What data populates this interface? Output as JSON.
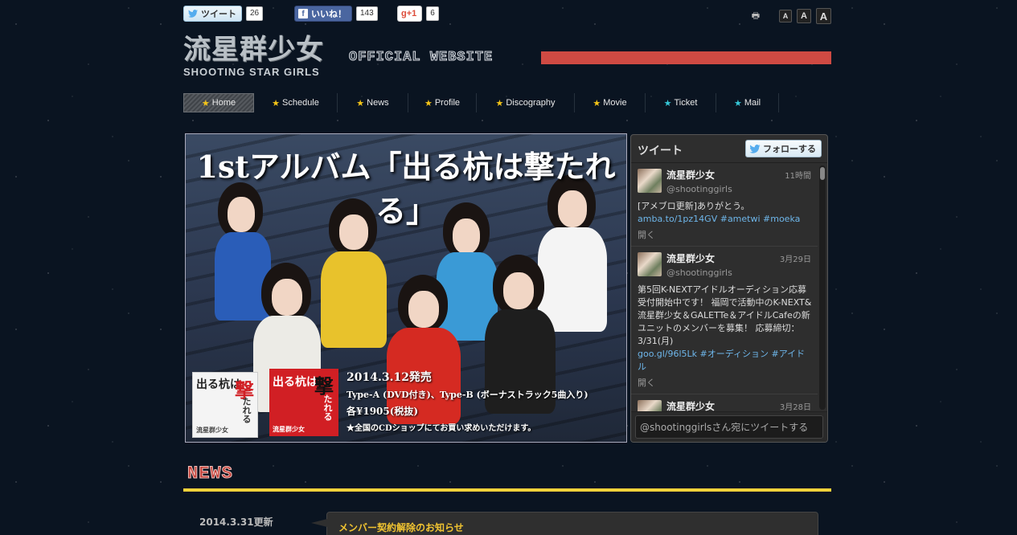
{
  "social": {
    "tweet_label": "ツイート",
    "tweet_count": "26",
    "like_label": "いいね！",
    "like_count": "143",
    "gplus_label": "+1",
    "gplus_count": "6",
    "font_sizes": [
      "A",
      "A",
      "A"
    ]
  },
  "header": {
    "logo_jp": "流星群少女",
    "logo_en": "SHOOTING STAR GIRLS",
    "tagline": "OFFICIAL WEBSITE",
    "bar_color": "#cf4a43"
  },
  "nav": [
    {
      "label": "Home",
      "star_color": "#f5c518"
    },
    {
      "label": "Schedule",
      "star_color": "#f5c518"
    },
    {
      "label": "News",
      "star_color": "#f5c518"
    },
    {
      "label": "Profile",
      "star_color": "#f5c518"
    },
    {
      "label": "Discography",
      "star_color": "#f5c518"
    },
    {
      "label": "Movie",
      "star_color": "#f5c518"
    },
    {
      "label": "Ticket",
      "star_color": "#35c8d8"
    },
    {
      "label": "Mail",
      "star_color": "#35c8d8"
    }
  ],
  "hero": {
    "title": "1stアルバム「出る杭は撃たれる」",
    "jacket_text_a": "出る杭は",
    "jacket_text_b": "撃",
    "jacket_text_c": "たれる",
    "jacket_brand": "流星群少女",
    "release": "2014.3.12発売",
    "types": "Type-A (DVD付き)、Type-B (ボーナストラック5曲入り)",
    "price": "各¥1905(税抜)",
    "note": "★全国のCDショップにてお買い求めいただけます。"
  },
  "twitter": {
    "header": "ツイート",
    "follow": "フォローする",
    "compose": "@shootinggirlsさん宛にツイートする",
    "tweets": [
      {
        "name": "流星群少女",
        "handle": "@shootinggirls",
        "time": "11時間",
        "text": "[アメブロ更新]ありがとう。",
        "links": "amba.to/1pz14GV #ametwi #moeka",
        "open": "開く"
      },
      {
        "name": "流星群少女",
        "handle": "@shootinggirls",
        "time": "3月29日",
        "text": "第5回K-NEXTアイドルオーディション応募受付開始中です！ 福岡で活動中のK-NEXT&流星群少女＆GALETTe＆アイドルCafeの新ユニットのメンバーを募集！ 応募締切：3/31(月)",
        "links": "goo.gl/96l5Lk #オーディション #アイドル",
        "open": "開く"
      },
      {
        "name": "流星群少女",
        "handle": "",
        "time": "3月28日",
        "text": "",
        "links": "",
        "open": ""
      }
    ]
  },
  "news": {
    "title": "NEWS",
    "date": "2014.3.31更新",
    "item": "メンバー契約解除のお知らせ",
    "underline_color": "#f0d23a"
  }
}
